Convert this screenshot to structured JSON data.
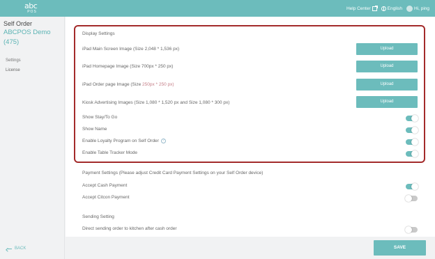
{
  "topbar": {
    "logo_main": "abc",
    "logo_sub": "POS",
    "help_center": "Help Center",
    "language": "English",
    "greeting": "Hi, ping"
  },
  "sidebar": {
    "title": "Self Order",
    "store_name": "ABCPOS Demo",
    "store_id": "(475)",
    "items": [
      {
        "label": "Settings"
      },
      {
        "label": "License"
      }
    ],
    "back_label": "BACK"
  },
  "display_settings": {
    "title": "Display Settings",
    "images": [
      {
        "label": "iPad Main Screen Image (Size 2,048 * 1,536 px)",
        "button": "Upload"
      },
      {
        "label": "iPad Homepage Image (Size 700px * 250 px)",
        "button": "Upload"
      },
      {
        "label_prefix": "iPad Order page Image (Size ",
        "label_accent": "250px * 250 px)",
        "button": "Upload"
      },
      {
        "label": "Kiosk Advertising Images (Size 1,080 * 1,520 px and Size 1,080 * 300 px)",
        "button": "Upload"
      }
    ],
    "toggles": [
      {
        "label": "Show Stay/To Go",
        "on": true
      },
      {
        "label": "Show Name",
        "on": true
      },
      {
        "label": "Enable Loyalty Program on Self Order",
        "on": true,
        "help": "?"
      },
      {
        "label": "Enable Table Tracker Mode",
        "on": true
      }
    ]
  },
  "payment_settings": {
    "title": "Payment Settings (Please adjust Credit Card Payment Settings on your Self Order device)",
    "toggles": [
      {
        "label": "Accept Cash Payment",
        "on": true
      },
      {
        "label": "Accept Citcon Payment",
        "on": false
      }
    ]
  },
  "sending_settings": {
    "title": "Sending Setting",
    "toggles": [
      {
        "label": "Direct sending order to kitchen after cash order",
        "on": false
      }
    ]
  },
  "footer": {
    "save_label": "SAVE"
  },
  "colors": {
    "accent": "#6cbcbc",
    "highlight_border": "#a32a2a",
    "toggle_off": "#c9c9c9"
  }
}
